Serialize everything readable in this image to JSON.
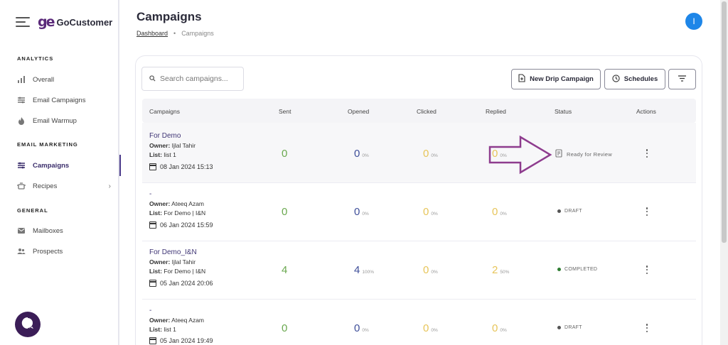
{
  "app": {
    "logo_mark": "ge",
    "logo_text": "GoCustomer"
  },
  "sidebar": {
    "sections": [
      {
        "title": "ANALYTICS",
        "items": [
          {
            "label": "Overall",
            "icon": "bar-chart-icon"
          },
          {
            "label": "Email Campaigns",
            "icon": "sliders-icon"
          },
          {
            "label": "Email Warmup",
            "icon": "flame-icon"
          }
        ]
      },
      {
        "title": "EMAIL MARKETING",
        "items": [
          {
            "label": "Campaigns",
            "icon": "sliders-icon",
            "active": true
          },
          {
            "label": "Recipes",
            "icon": "pot-icon",
            "chevron": "›"
          }
        ]
      },
      {
        "title": "GENERAL",
        "items": [
          {
            "label": "Mailboxes",
            "icon": "mail-icon"
          },
          {
            "label": "Prospects",
            "icon": "people-icon"
          }
        ]
      }
    ]
  },
  "header": {
    "title": "Campaigns",
    "breadcrumb": [
      "Dashboard",
      "Campaigns"
    ],
    "avatar_initial": "I"
  },
  "toolbar": {
    "search_placeholder": "Search campaigns...",
    "new_drip_label": "New Drip Campaign",
    "schedules_label": "Schedules"
  },
  "table": {
    "columns": [
      "Campaigns",
      "Sent",
      "Opened",
      "Clicked",
      "Replied",
      "Status",
      "Actions"
    ],
    "rows": [
      {
        "name": "For Demo",
        "owner_label": "Owner:",
        "owner": " Ijlal Tahir",
        "list_label": "List:",
        "list": " list 1",
        "date": "08 Jan 2024 15:13",
        "sent": "0",
        "opened": "0",
        "opened_pct": "0%",
        "clicked": "0",
        "clicked_pct": "0%",
        "replied": "0",
        "replied_pct": "0%",
        "status": "Ready for Review"
      },
      {
        "name": "-",
        "owner_label": "Owner:",
        "owner": " Ateeq Azam",
        "list_label": "List:",
        "list": " For Demo | I&N",
        "date": "06 Jan 2024 15:59",
        "sent": "0",
        "opened": "0",
        "opened_pct": "0%",
        "clicked": "0",
        "clicked_pct": "0%",
        "replied": "0",
        "replied_pct": "0%",
        "status": "DRAFT"
      },
      {
        "name": "For Demo_I&N",
        "owner_label": "Owner:",
        "owner": " Ijlal Tahir",
        "list_label": "List:",
        "list": " For Demo | I&N",
        "date": "05 Jan 2024 20:06",
        "sent": "4",
        "opened": "4",
        "opened_pct": "100%",
        "clicked": "0",
        "clicked_pct": "0%",
        "replied": "2",
        "replied_pct": "50%",
        "status": "COMPLETED"
      },
      {
        "name": "-",
        "owner_label": "Owner:",
        "owner": " Ateeq Azam",
        "list_label": "List:",
        "list": " list 1",
        "date": "05 Jan 2024 19:49",
        "sent": "0",
        "opened": "0",
        "opened_pct": "0%",
        "clicked": "0",
        "clicked_pct": "0%",
        "replied": "0",
        "replied_pct": "0%",
        "status": "DRAFT"
      }
    ]
  },
  "colors": {
    "brand": "#5b2a7a",
    "sent_green": "#6aa84f",
    "opened_blue": "#3f4f9a",
    "clicked_yellow": "#e7c55a",
    "status_draft": "#555555",
    "status_completed": "#2e7d32",
    "annotation_arrow": "#8e3c8e"
  }
}
